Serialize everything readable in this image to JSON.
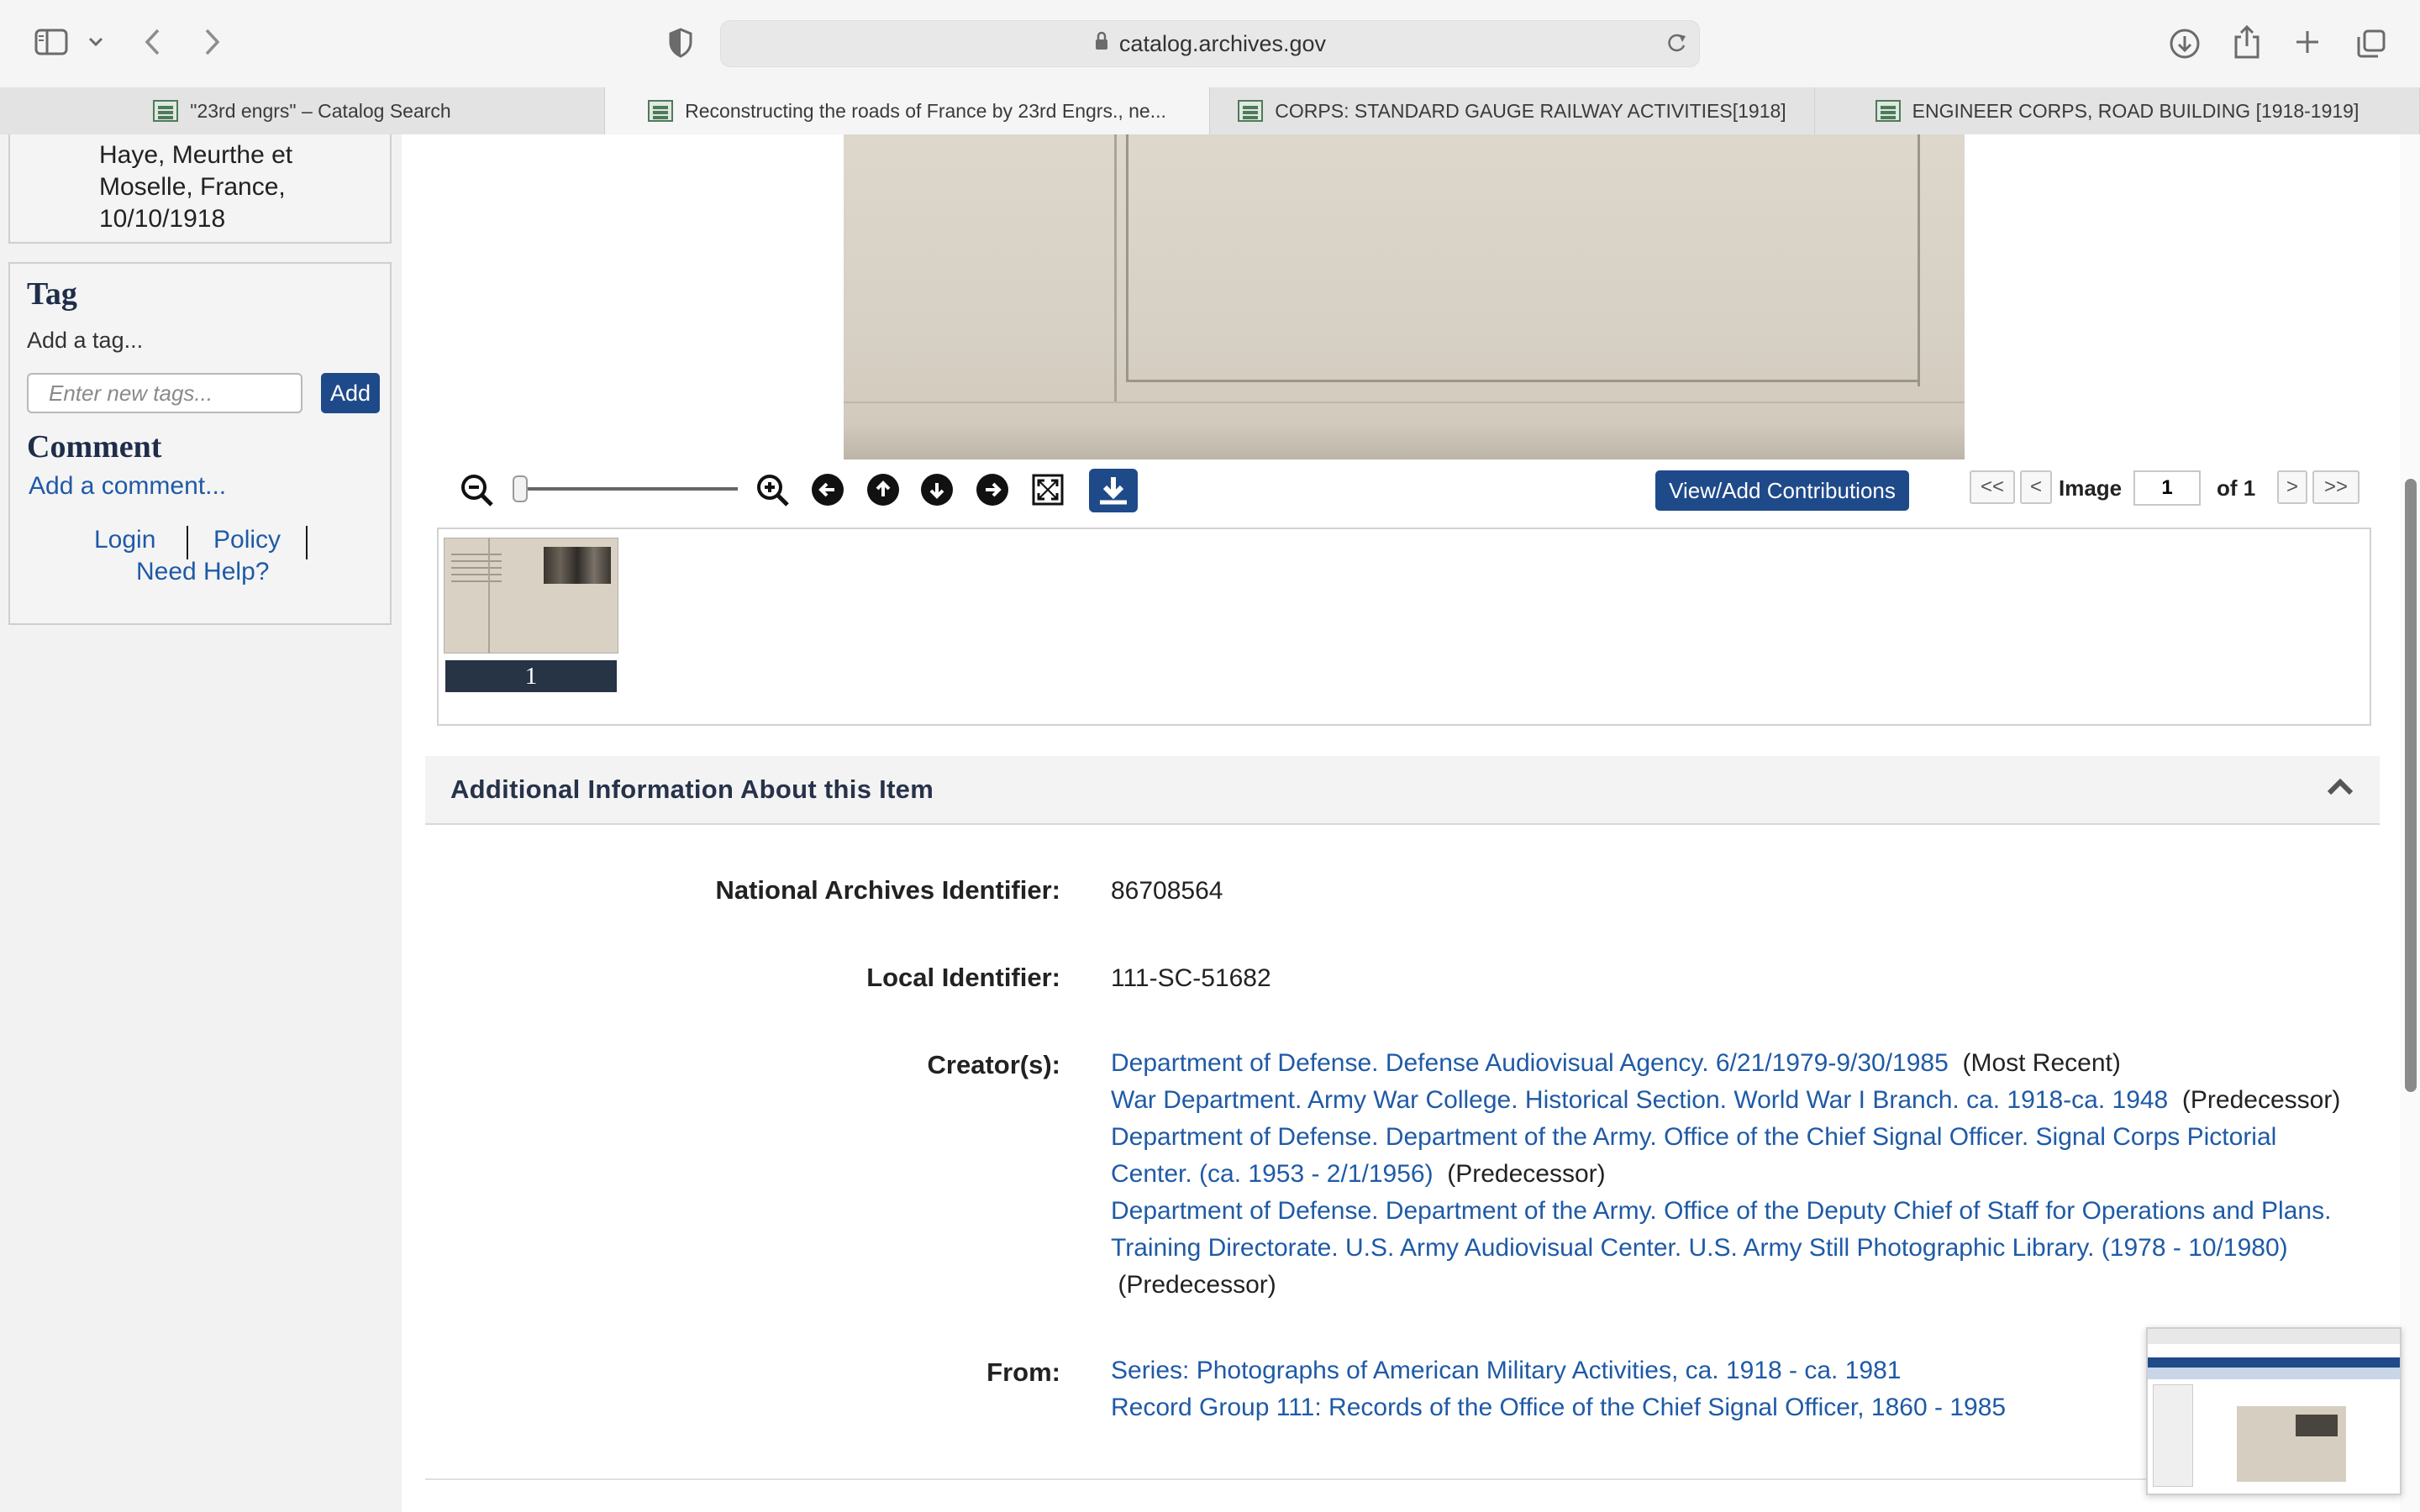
{
  "browser": {
    "url": "catalog.archives.gov",
    "tabs": [
      {
        "label": "\"23rd engrs\" – Catalog Search",
        "active": false
      },
      {
        "label": "Reconstructing the roads of France by 23rd Engrs., ne...",
        "active": true
      },
      {
        "label": "CORPS: STANDARD GAUGE RAILWAY ACTIVITIES[1918]",
        "active": false
      },
      {
        "label": "ENGINEER CORPS, ROAD BUILDING [1918-1919]",
        "active": false
      }
    ],
    "icons": [
      "sidebar-icon",
      "chevron-down-icon",
      "back-icon",
      "forward-icon",
      "privacy-shield-icon",
      "lock-icon",
      "reload-icon",
      "download-icon",
      "share-icon",
      "new-tab-icon",
      "tab-overview-icon"
    ]
  },
  "sidebar": {
    "place_lines": [
      "Haye, Meurthe et",
      "Moselle, France,",
      "10/10/1918"
    ],
    "tag_title": "Tag",
    "tag_hint": "Add a tag...",
    "tag_placeholder": "Enter new tags...",
    "tag_add": "Add",
    "comment_title": "Comment",
    "comment_link": "Add a comment...",
    "login": "Login",
    "policy": "Policy",
    "help": "Need Help?"
  },
  "viewer": {
    "contributions_label": "View/Add Contributions",
    "first_label": "<<",
    "prev_label": "<",
    "image_label": "Image",
    "current_page": "1",
    "of_label": "of 1",
    "next_label": ">",
    "last_label": ">>",
    "thumbnail_number": "1",
    "zoom_level": 0.0
  },
  "additional_info": {
    "title": "Additional Information About this Item",
    "na_label": "National Archives Identifier:",
    "na_value": "86708564",
    "local_label": "Local Identifier:",
    "local_value": "111-SC-51682",
    "creators_label": "Creator(s):",
    "creators": [
      {
        "link": "Department of Defense. Defense Audiovisual Agency. 6/21/1979-9/30/1985",
        "note": "(Most Recent)"
      },
      {
        "link": "War Department. Army War College. Historical Section. World War I Branch. ca. 1918-ca. 1948",
        "note": "(Predecessor)"
      },
      {
        "link_line1": "Department of Defense. Department of the Army. Office of the Chief Signal Officer. Signal Corps Pictorial",
        "link_line2": "Center. (ca. 1953 - 2/1/1956)",
        "note": "(Predecessor)"
      },
      {
        "link_line1": "Department of Defense. Department of the Army. Office of the Deputy Chief of Staff for Operations and Plans.",
        "link_line2": "Training Directorate. U.S. Army Audiovisual Center. U.S. Army Still Photographic Library. (1978 - 10/1980)",
        "note": "(Predecessor)"
      }
    ],
    "from_label": "From:",
    "from_items": [
      "Series: Photographs of American Military Activities, ca. 1918 - ca. 1981",
      "Record Group 111: Records of the Office of the Chief Signal Officer, 1860 - 1985"
    ]
  },
  "colors": {
    "accent": "#1f4a8a",
    "link": "#1f5aa6",
    "heading": "#27324a"
  }
}
